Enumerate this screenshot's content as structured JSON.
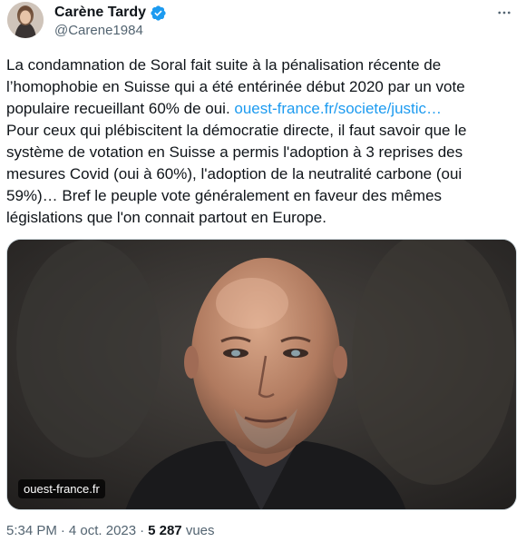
{
  "author": {
    "display_name": "Carène Tardy",
    "handle": "@Carene1984",
    "verified": true
  },
  "colors": {
    "verified": "#1d9bf0",
    "link": "#1d9bf0",
    "text": "#0f1419",
    "secondary": "#536471"
  },
  "tweet": {
    "text_part1": "La condamnation de Soral fait suite à la pénalisation récente de l’homophobie en Suisse qui a été entérinée début 2020 par un vote populaire recueillant 60% de oui. ",
    "link_text": "ouest-france.fr/societe/justic…",
    "text_part2": "Pour ceux qui plébiscitent la démocratie directe, il faut savoir que le système de votation en Suisse a permis l'adoption à 3 reprises des mesures Covid (oui à 60%), l'adoption de la neutralité carbone (oui 59%)… Bref le peuple vote généralement en faveur des mêmes législations que l'on connait partout en Europe."
  },
  "media": {
    "source_label": "ouest-france.fr"
  },
  "meta": {
    "time": "5:34 PM",
    "separator": "·",
    "date": "4 oct. 2023",
    "views_count": "5 287",
    "views_label": "vues"
  },
  "icons": {
    "more": "more-horizontal-icon",
    "verified": "verified-badge-icon"
  }
}
